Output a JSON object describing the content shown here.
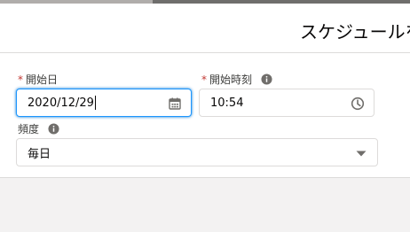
{
  "modal": {
    "title": "スケジュールを"
  },
  "form": {
    "start_date": {
      "label": "開始日",
      "required": "*",
      "value": "2020/12/29"
    },
    "start_time": {
      "label": "開始時刻",
      "required": "*",
      "value": "10:54"
    },
    "frequency": {
      "label": "頻度",
      "value": "毎日"
    }
  },
  "icons": {
    "calendar": "calendar-icon",
    "clock": "clock-icon",
    "info": "info-icon",
    "dropdown": "chevron-down-icon"
  },
  "colors": {
    "required": "#c23934",
    "focus": "#1b96ff",
    "icon": "#706e6b"
  }
}
